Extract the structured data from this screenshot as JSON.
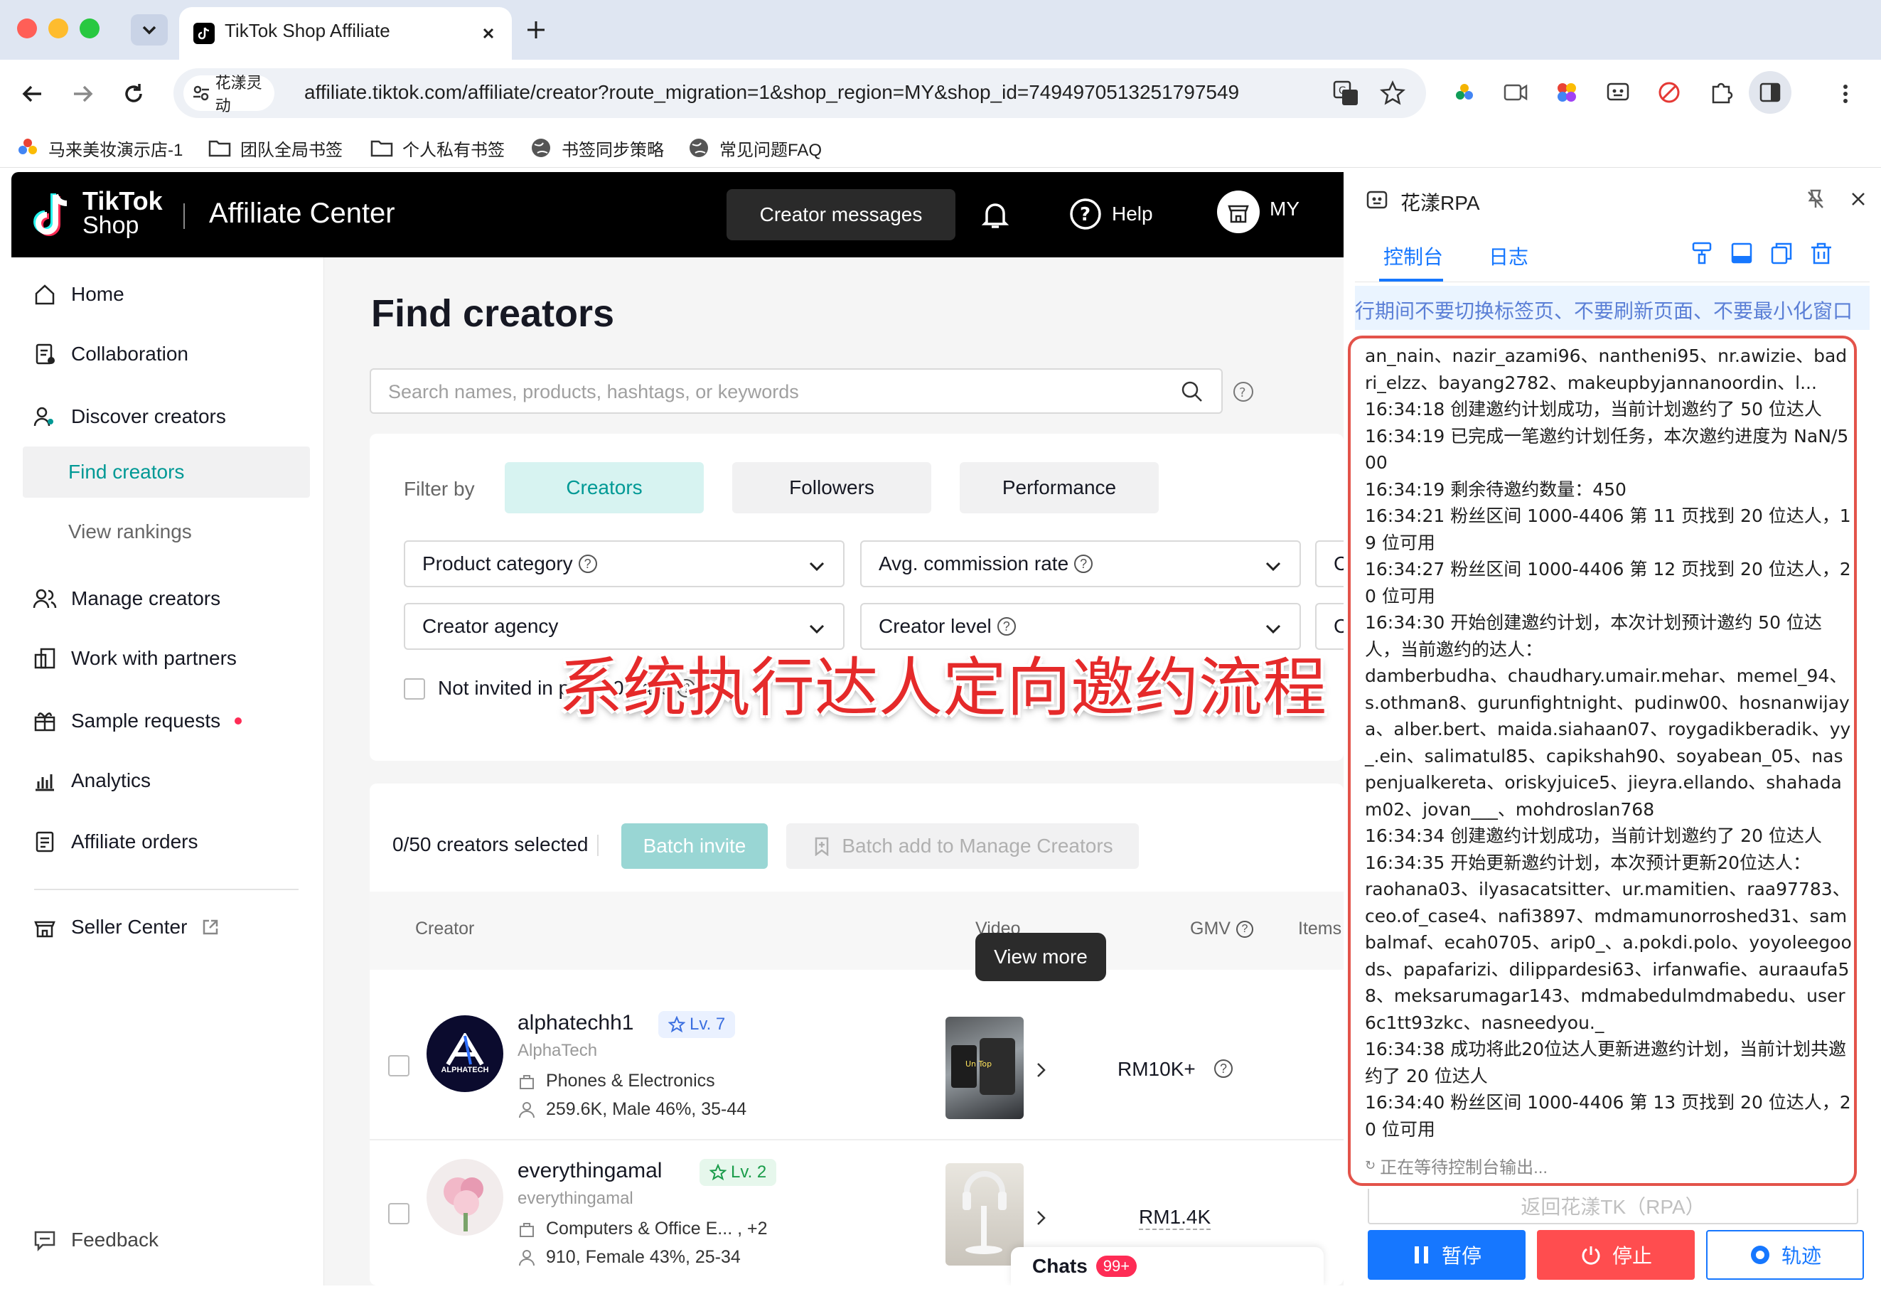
{
  "browser": {
    "tab_title": "TikTok Shop Affiliate",
    "url_badge": "花漾灵动",
    "url": "affiliate.tiktok.com/affiliate/creator?route_migration=1&shop_region=MY&shop_id=7494970513251797549",
    "bookmarks": [
      "马来美妆演示店-1",
      "团队全局书签",
      "个人私有书签",
      "书签同步策略",
      "常见问题FAQ"
    ]
  },
  "header": {
    "logo_line1": "TikTok",
    "logo_line2": "Shop",
    "app_title": "Affiliate Center",
    "creator_messages": "Creator messages",
    "help": "Help",
    "region": "MY"
  },
  "sidebar": {
    "items": [
      {
        "label": "Home",
        "icon": "home-icon"
      },
      {
        "label": "Collaboration",
        "icon": "collaboration-icon"
      },
      {
        "label": "Discover creators",
        "icon": "discover-icon"
      },
      {
        "label": "Find creators",
        "icon": ""
      },
      {
        "label": "View rankings",
        "icon": ""
      },
      {
        "label": "Manage creators",
        "icon": "manage-icon"
      },
      {
        "label": "Work with partners",
        "icon": "partners-icon"
      },
      {
        "label": "Sample requests",
        "icon": "gift-icon"
      },
      {
        "label": "Analytics",
        "icon": "analytics-icon"
      },
      {
        "label": "Affiliate orders",
        "icon": "orders-icon"
      },
      {
        "label": "Seller Center",
        "icon": "store-icon"
      }
    ],
    "feedback": "Feedback"
  },
  "main": {
    "title": "Find creators",
    "search_placeholder": "Search names, products, hashtags, or keywords",
    "filter_by": "Filter by",
    "filter_tabs": [
      "Creators",
      "Followers",
      "Performance"
    ],
    "dropdowns": [
      "Product category",
      "Avg. commission rate",
      "Co",
      "Creator agency",
      "Creator level",
      "Co"
    ],
    "not_invited": "Not invited in past 90 days",
    "overlay_text": "系统执行达人定向邀约流程",
    "selected_count": "0/50 creators selected",
    "batch_invite": "Batch invite",
    "batch_add": "Batch add to Manage Creators",
    "columns": [
      "Creator",
      "Video",
      "GMV",
      "Items sol"
    ],
    "tooltip": "View more",
    "rows": [
      {
        "name": "alphatechh1",
        "level": "Lv. 7",
        "handle": "AlphaTech",
        "category": "Phones & Electronics",
        "audience": "259.6K, Male 46%, 35-44",
        "gmv": "RM10K+",
        "avatar_text": "ALPHATECH"
      },
      {
        "name": "everythingamal",
        "level": "Lv. 2",
        "handle": "everythingamal",
        "category": "Computers & Office E... , +2",
        "audience": "910, Female 43%, 25-34",
        "gmv": "RM1.4K",
        "avatar_text": ""
      }
    ],
    "chats": "Chats",
    "chats_badge": "99+"
  },
  "panel": {
    "title": "花漾RPA",
    "tabs": [
      "控制台",
      "日志"
    ],
    "notice": "行期间不要切换标签页、不要刷新页面、不要最小化窗口",
    "log_lines": [
      "an_nain、nazir_azami96、nantheni95、nr.awizie、badri_elzz、bayang2782、makeupbyjannanoordin、l...",
      "16:34:18 创建邀约计划成功，当前计划邀约了 50 位达人",
      "16:34:19 已完成一笔邀约计划任务，本次邀约进度为 NaN/500",
      "16:34:19 剩余待邀约数量：450",
      "16:34:21 粉丝区间 1000-4406 第 11 页找到 20 位达人，19 位可用",
      "16:34:27 粉丝区间 1000-4406 第 12 页找到 20 位达人，20 位可用",
      "16:34:30 开始创建邀约计划，本次计划预计邀约 50 位达人，当前邀约的达人：",
      "damberbudha、chaudhary.umair.mehar、memel_94、s.othman8、gurunfightnight、pudinw00、hosnanwijaya、alber.bert、maida.siahaan07、roygadikberadik、yy_.ein、salimatul85、capikshah90、soyabean_05、naspenjualkereta、oriskyjuice5、jieyra.ellando、shahadam02、jovan___、mohdroslan768",
      "16:34:34 创建邀约计划成功，当前计划邀约了 20 位达人",
      "16:34:35 开始更新邀约计划，本次预计更新20位达人：",
      "raohana03、ilyasacatsitter、ur.mamitien、raa97783、ceo.of_case4、nafi3897、mdmamunorroshed31、sambalmaf、ecah0705、arip0_、a.pokdi.polo、yoyoleegoods、papafarizi、dilippardesi63、irfanwafie、auraaufa58、meksarumagar143、mdmabedulmdmabedu、user6c1tt93zkc、nasneedyou._",
      "16:34:38 成功将此20位达人更新进邀约计划，当前计划共邀约了 20 位达人",
      "16:34:40 粉丝区间 1000-4406 第 13 页找到 20 位达人，20 位可用"
    ],
    "waiting": "正在等待控制台输出...",
    "return_btn": "返回花漾TK（RPA）",
    "pause": "暂停",
    "stop": "停止",
    "track": "轨迹"
  },
  "colors": {
    "accent_teal": "#009995",
    "panel_blue": "#1677ff",
    "stop_red": "#ff4d4f",
    "log_border": "#e3534a"
  }
}
